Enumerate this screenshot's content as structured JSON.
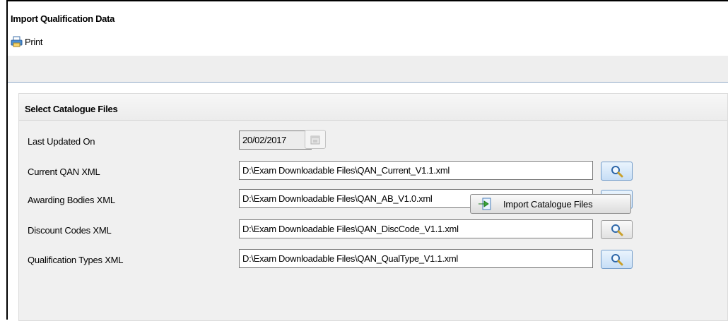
{
  "page": {
    "title": "Import Qualification Data"
  },
  "toolbar": {
    "print_label": "Print"
  },
  "panel": {
    "title": "Select Catalogue Files",
    "last_updated": {
      "label": "Last Updated On",
      "value": "20/02/2017"
    },
    "fields": [
      {
        "label": "Current QAN XML",
        "value": "D:\\Exam Downloadable Files\\QAN_Current_V1.1.xml"
      },
      {
        "label": "Awarding Bodies XML",
        "value": "D:\\Exam Downloadable Files\\QAN_AB_V1.0.xml"
      },
      {
        "label": "Discount Codes XML",
        "value": "D:\\Exam Downloadable Files\\QAN_DiscCode_V1.1.xml"
      },
      {
        "label": "Qualification Types XML",
        "value": "D:\\Exam Downloadable Files\\QAN_QualType_V1.1.xml"
      }
    ],
    "import_button_label": "Import Catalogue Files"
  },
  "icons": {
    "print": "printer-icon",
    "calendar": "calendar-icon",
    "search": "magnifier-icon",
    "import": "import-arrow-icon"
  },
  "colors": {
    "panel_bg": "#f0f0f0",
    "toolbar_strip": "#eeeeee",
    "search_button": "#c7def6"
  }
}
